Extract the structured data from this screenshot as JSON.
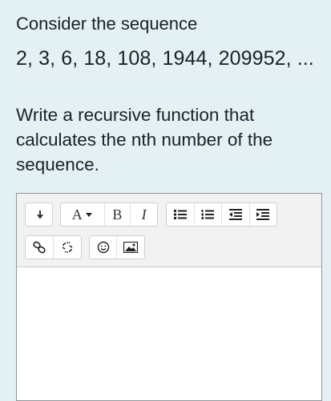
{
  "question": {
    "intro": "Consider the sequence",
    "sequence": "2, 3, 6, 18, 108, 1944, 209952, ...",
    "task": "Write a recursive function that calculates the nth number of the sequence."
  },
  "editor": {
    "toolbar": {
      "toggle_icon": "toolbar-toggle-icon",
      "font_label": "A",
      "bold_label": "B",
      "italic_label": "I",
      "icons": [
        "unordered-list-icon",
        "ordered-list-icon",
        "outdent-icon",
        "indent-icon",
        "link-icon",
        "unlink-icon",
        "emoji-icon",
        "image-icon"
      ]
    },
    "content": ""
  }
}
